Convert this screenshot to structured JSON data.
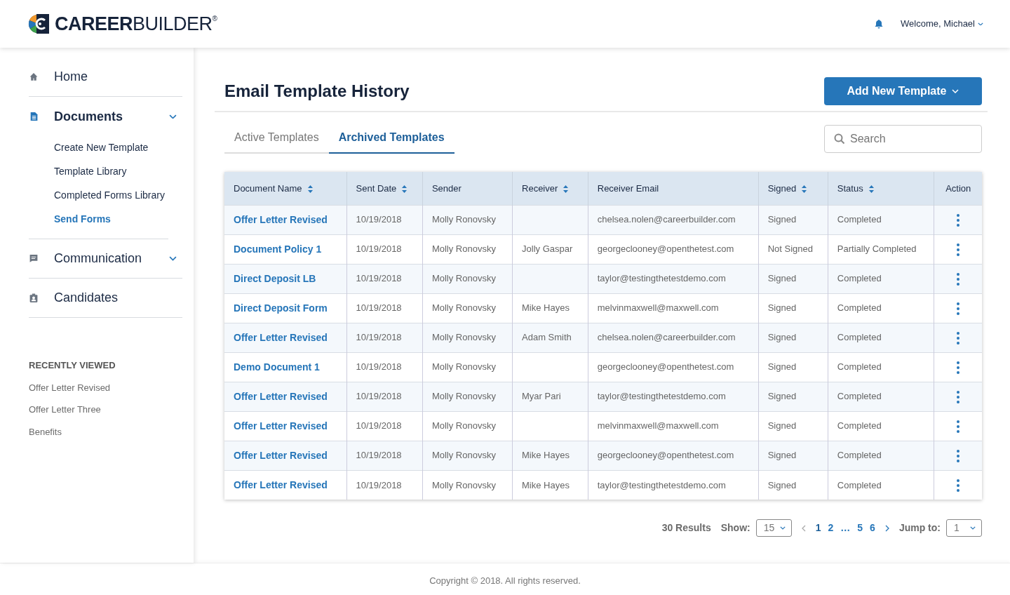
{
  "header": {
    "logo": "**CAREER**BUILDER$^{®}$",
    "welcome": "Welcome, Michael"
  },
  "sidebar": {
    "items": [
      {
        "label": "Home",
        "expandable": false,
        "expanded": false
      },
      {
        "label": "Documents",
        "expandable": true,
        "expanded": true,
        "children": [
          {
            "label": "Create New Template",
            "selected": false
          },
          {
            "label": "Template Library",
            "selected": false
          },
          {
            "label": "Completed Forms Library",
            "selected": false
          },
          {
            "label": "Send Forms",
            "selected": true
          }
        ]
      },
      {
        "label": "Communication",
        "expandable": true,
        "expanded": false
      },
      {
        "label": "Candidates",
        "expandable": false,
        "expanded": false
      }
    ],
    "recent_title": "RECENTLY VIEWED",
    "recent": [
      "Offer Letter Revised",
      "Offer Letter Three",
      "Benefits"
    ]
  },
  "page": {
    "title": "Email Template History",
    "add_button": "Add New Template"
  },
  "tabs": [
    {
      "label": "Active Templates",
      "selected": false
    },
    {
      "label": "Archived Templates",
      "selected": true
    }
  ],
  "search": {
    "placeholder": "Search"
  },
  "table": {
    "columns": [
      {
        "label": "Document Name",
        "sortable": true
      },
      {
        "label": "Sent Date",
        "sortable": true
      },
      {
        "label": "Sender",
        "sortable": false
      },
      {
        "label": "Receiver",
        "sortable": true
      },
      {
        "label": "Receiver Email",
        "sortable": false
      },
      {
        "label": "Signed",
        "sortable": true
      },
      {
        "label": "Status",
        "sortable": true
      },
      {
        "label": "Action",
        "sortable": false
      }
    ],
    "rows": [
      [
        "Offer Letter Revised",
        "10/19/2018",
        "Molly Ronovsky",
        "",
        "chelsea.nolen@careerbuilder.com",
        "Signed",
        "Completed"
      ],
      [
        "Document Policy 1",
        "10/19/2018",
        "Molly Ronovsky",
        "Jolly Gaspar",
        "georgeclooney@openthetest.com",
        "Not Signed",
        "Partially Completed"
      ],
      [
        "Direct Deposit LB",
        "10/19/2018",
        "Molly Ronovsky",
        "",
        "taylor@testingthetestdemo.com",
        "Signed",
        "Completed"
      ],
      [
        "Direct Deposit Form",
        "10/19/2018",
        "Molly Ronovsky",
        "Mike Hayes",
        "melvinmaxwell@maxwell.com",
        "Signed",
        "Completed"
      ],
      [
        "Offer Letter Revised",
        "10/19/2018",
        "Molly Ronovsky",
        "Adam Smith",
        "chelsea.nolen@careerbuilder.com",
        "Signed",
        "Completed"
      ],
      [
        "Demo Document 1",
        "10/19/2018",
        "Molly Ronovsky",
        "",
        "georgeclooney@openthetest.com",
        "Signed",
        "Completed"
      ],
      [
        "Offer Letter Revised",
        "10/19/2018",
        "Molly Ronovsky",
        "Myar Pari",
        "taylor@testingthetestdemo.com",
        "Signed",
        "Completed"
      ],
      [
        "Offer Letter Revised",
        "10/19/2018",
        "Molly Ronovsky",
        "",
        "melvinmaxwell@maxwell.com",
        "Signed",
        "Completed"
      ],
      [
        "Offer Letter Revised",
        "10/19/2018",
        "Molly Ronovsky",
        "Mike Hayes",
        "georgeclooney@openthetest.com",
        "Signed",
        "Completed"
      ],
      [
        "Offer Letter Revised",
        "10/19/2018",
        "Molly Ronovsky",
        "Mike Hayes",
        "taylor@testingthetestdemo.com",
        "Signed",
        "Completed"
      ]
    ]
  },
  "pagination": {
    "results": "30 Results",
    "show_label": "Show:",
    "show_value": "15",
    "pages": [
      {
        "label": "1",
        "selected": true
      },
      {
        "label": "2",
        "selected": false
      },
      {
        "label": "…",
        "selected": false
      },
      {
        "label": "5",
        "selected": false
      },
      {
        "label": "6",
        "selected": false
      }
    ],
    "jump_label": "Jump to:",
    "jump_value": "1"
  },
  "footer": "Copyright © 2018. All rights reserved."
}
